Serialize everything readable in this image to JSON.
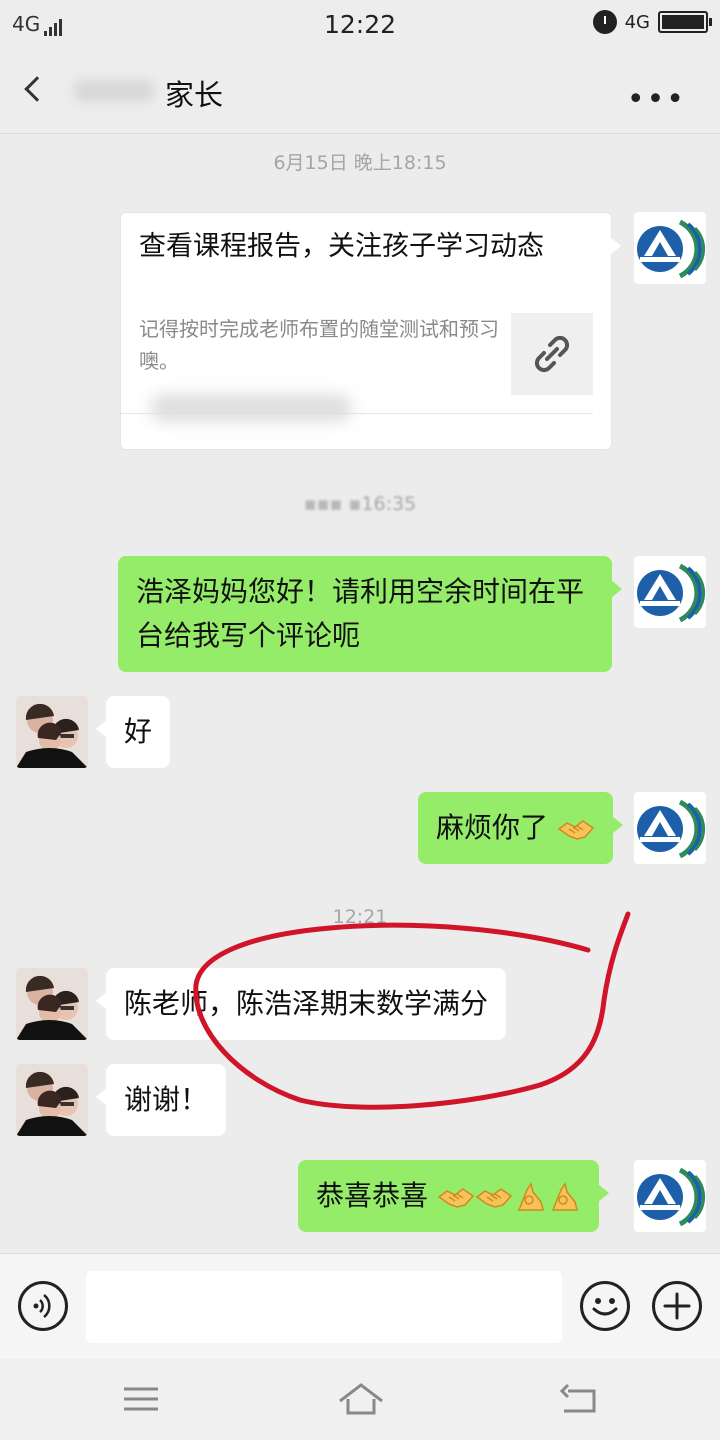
{
  "status_bar": {
    "network_left": "4G",
    "time": "12:22",
    "network_right": "4G"
  },
  "header": {
    "title": "家长"
  },
  "messages": {
    "ts1": "6月15日 晚上18:15",
    "card": {
      "title": "查看课程报告，关注孩子学习动态",
      "description": "记得按时完成老师布置的随堂测试和预习噢。",
      "icon": "link-icon"
    },
    "ts2": "16:35",
    "m1": "浩泽妈妈您好！请利用空余时间在平台给我写个评论呃",
    "m2": "好",
    "m3": "麻烦你了",
    "m3_emoji": "handshake-emoji",
    "ts3": "12:21",
    "m4": "陈老师，陈浩泽期末数学满分",
    "m5": "谢谢！",
    "m6": "恭喜恭喜",
    "m6_emojis": [
      "handshake-emoji",
      "handshake-emoji",
      "ok-hand-emoji",
      "ok-hand-emoji"
    ]
  },
  "input_bar": {
    "value": "",
    "icons": [
      "voice-icon",
      "emoji-icon",
      "plus-icon"
    ]
  },
  "system_nav": [
    "menu-icon",
    "home-icon",
    "back-icon"
  ],
  "colors": {
    "background": "#ececec",
    "outgoing_bubble": "#95ec69",
    "incoming_bubble": "#ffffff",
    "annotation": "#d0152a"
  }
}
